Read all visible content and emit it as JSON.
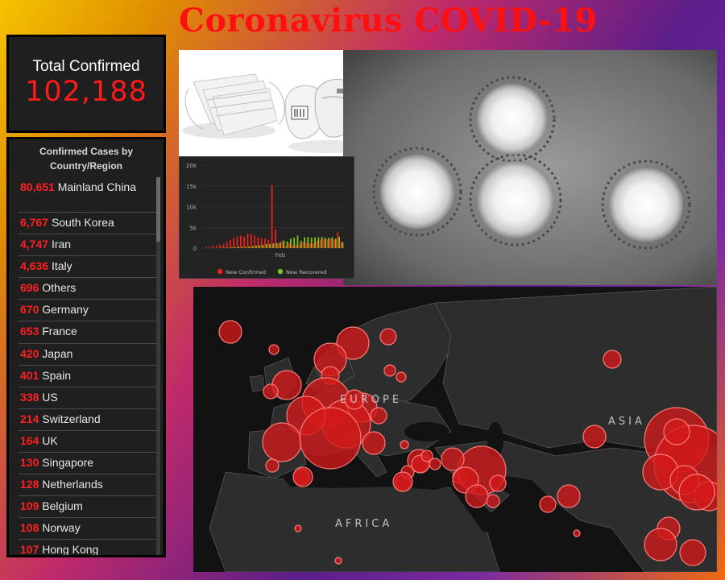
{
  "title": "Coronavirus COVID-19",
  "total": {
    "label": "Total Confirmed",
    "value": "102,188"
  },
  "list": {
    "header_line1": "Confirmed Cases by",
    "header_line2": "Country/Region",
    "rows": [
      {
        "num": "80,651",
        "name": "Mainland China"
      },
      {
        "num": "6,767",
        "name": "South Korea"
      },
      {
        "num": "4,747",
        "name": "Iran"
      },
      {
        "num": "4,636",
        "name": "Italy"
      },
      {
        "num": "696",
        "name": "Others"
      },
      {
        "num": "670",
        "name": "Germany"
      },
      {
        "num": "653",
        "name": "France"
      },
      {
        "num": "420",
        "name": "Japan"
      },
      {
        "num": "401",
        "name": "Spain"
      },
      {
        "num": "338",
        "name": "US"
      },
      {
        "num": "214",
        "name": "Switzerland"
      },
      {
        "num": "164",
        "name": "UK"
      },
      {
        "num": "130",
        "name": "Singapore"
      },
      {
        "num": "128",
        "name": "Netherlands"
      },
      {
        "num": "109",
        "name": "Belgium"
      },
      {
        "num": "108",
        "name": "Norway"
      },
      {
        "num": "107",
        "name": "Hong Kong"
      }
    ]
  },
  "chart": {
    "y_ticks": [
      "20k",
      "15k",
      "10k",
      "5k",
      "0"
    ],
    "x_label": "Feb",
    "legend": [
      {
        "label": "New Confirmed",
        "color": "#e8211d"
      },
      {
        "label": "New Recovered",
        "color": "#7ac21c"
      }
    ],
    "confirmed": [
      0.3,
      0.3,
      0.5,
      0.6,
      0.8,
      1.0,
      1.5,
      2.0,
      2.5,
      2.8,
      3.0,
      2.7,
      3.5,
      3.4,
      3.0,
      2.6,
      2.4,
      2.3,
      2.0,
      15.2,
      4.5,
      1.2,
      1.8,
      0.5,
      1.2,
      0.6,
      0.8,
      0.9,
      1.4,
      1.3,
      1.1,
      1.2,
      1.7,
      2.0,
      2.2,
      2.1,
      2.3,
      2.0,
      3.8,
      1.6
    ],
    "recovered": [
      0,
      0,
      0,
      0,
      0.1,
      0.1,
      0.1,
      0.2,
      0.2,
      0.3,
      0.3,
      0.3,
      0.4,
      0.5,
      0.6,
      0.7,
      0.8,
      1.0,
      1.0,
      1.1,
      1.2,
      1.4,
      1.8,
      1.6,
      2.3,
      2.5,
      3.0,
      1.8,
      2.6,
      2.7,
      2.5,
      2.6,
      2.6,
      2.7,
      2.5,
      2.5,
      2.6,
      2.3,
      2.7,
      1.4
    ]
  },
  "map": {
    "labels": [
      "EUROPE",
      "ASIA",
      "AFRICA"
    ],
    "dot_color": "#d41a1a"
  }
}
